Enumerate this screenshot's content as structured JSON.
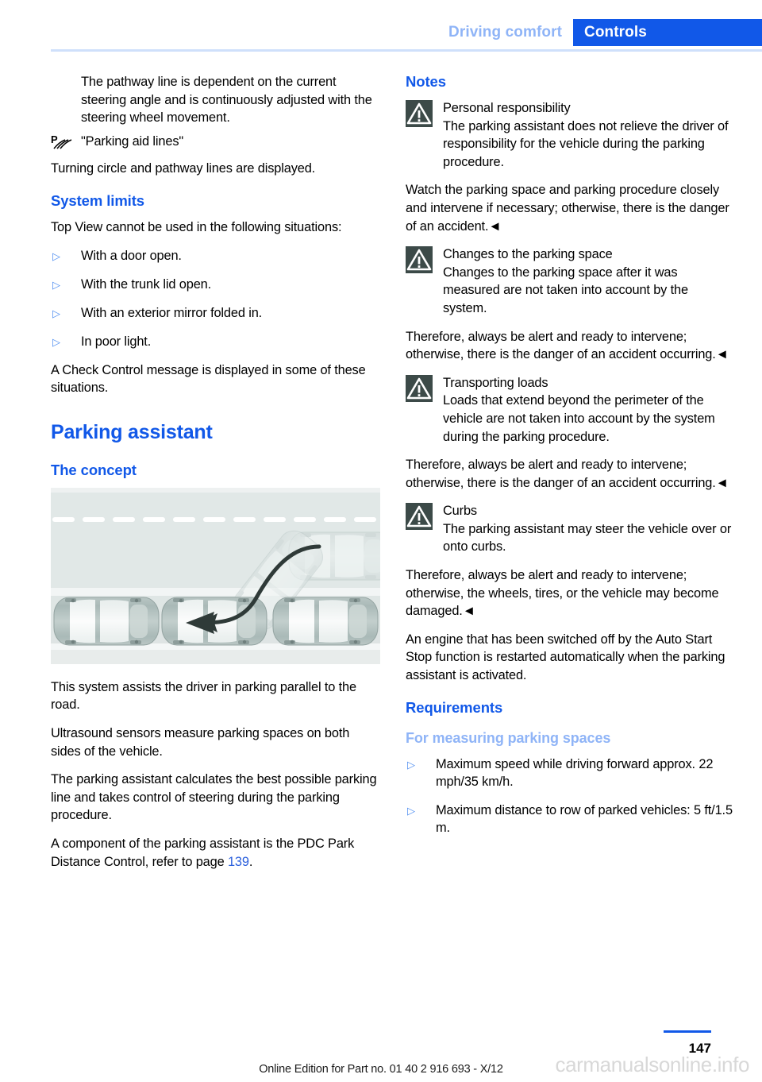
{
  "header": {
    "breadcrumb_inactive": "Driving comfort",
    "breadcrumb_active": "Controls",
    "accent_color": "#1158e8",
    "inactive_color": "#8fb4f7"
  },
  "left_column": {
    "intro_paragraph": "The pathway line is dependent on the current steering angle and is continuously adjusted with the steering wheel movement.",
    "symbol_caption": "\"Parking aid lines\"",
    "symbol_name": "parking-aid-lines-icon",
    "symbol_followup": "Turning circle and pathway lines are displayed.",
    "system_limits": {
      "heading": "System limits",
      "intro": "Top View cannot be used in the following situations:",
      "bullets": [
        "With a door open.",
        "With the trunk lid open.",
        "With an exterior mirror folded in.",
        "In poor light."
      ],
      "outro": "A Check Control message is displayed in some of these situations."
    },
    "parking_assistant": {
      "heading": "Parking assistant",
      "concept_heading": "The concept",
      "figure_alt": "Top-down illustration of a vehicle parallel parking between two parked cars with a curved path arrow",
      "paragraphs": [
        "This system assists the driver in parking parallel to the road.",
        "Ultrasound sensors measure parking spaces on both sides of the vehicle."
      ],
      "paragraph_3": "The parking assistant calculates the best possible parking line and takes control of steering during the parking procedure.",
      "pdc_prefix": "A component of the parking assistant is the PDC Park Distance Control, refer to page ",
      "pdc_page": "139",
      "pdc_suffix": "."
    }
  },
  "right_column": {
    "notes_heading": "Notes",
    "warnings": [
      {
        "title": "Personal responsibility",
        "body": "The parking assistant does not relieve the driver of responsibility for the vehicle during the parking procedure.",
        "continuation": "Watch the parking space and parking procedure closely and intervene if necessary; otherwise, there is the danger of an accident.◄"
      },
      {
        "title": "Changes to the parking space",
        "body": "Changes to the parking space after it was measured are not taken into account by the system.",
        "continuation": "Therefore, always be alert and ready to intervene; otherwise, there is the danger of an accident occurring.◄"
      },
      {
        "title": "Transporting loads",
        "body": "Loads that extend beyond the perimeter of the vehicle are not taken into account by the system during the parking procedure.",
        "continuation": "Therefore, always be alert and ready to intervene; otherwise, there is the danger of an accident occurring.◄"
      },
      {
        "title": "Curbs",
        "body": "The parking assistant may steer the vehicle over or onto curbs.",
        "continuation": "Therefore, always be alert and ready to intervene; otherwise, the wheels, tires, or the vehicle may become damaged.◄"
      }
    ],
    "auto_start_stop": "An engine that has been switched off by the Auto Start Stop function is restarted automatically when the parking assistant is activated.",
    "requirements": {
      "heading": "Requirements",
      "sub_heading": "For measuring parking spaces",
      "bullets": [
        "Maximum speed while driving forward approx. 22 mph/35 km/h.",
        "Maximum distance to row of parked vehicles: 5 ft/1.5 m."
      ]
    }
  },
  "footer": {
    "page_number": "147",
    "edition_text": "Online Edition for Part no. 01 40 2 916 693 - X/12",
    "watermark": "carmanualsonline.info"
  }
}
